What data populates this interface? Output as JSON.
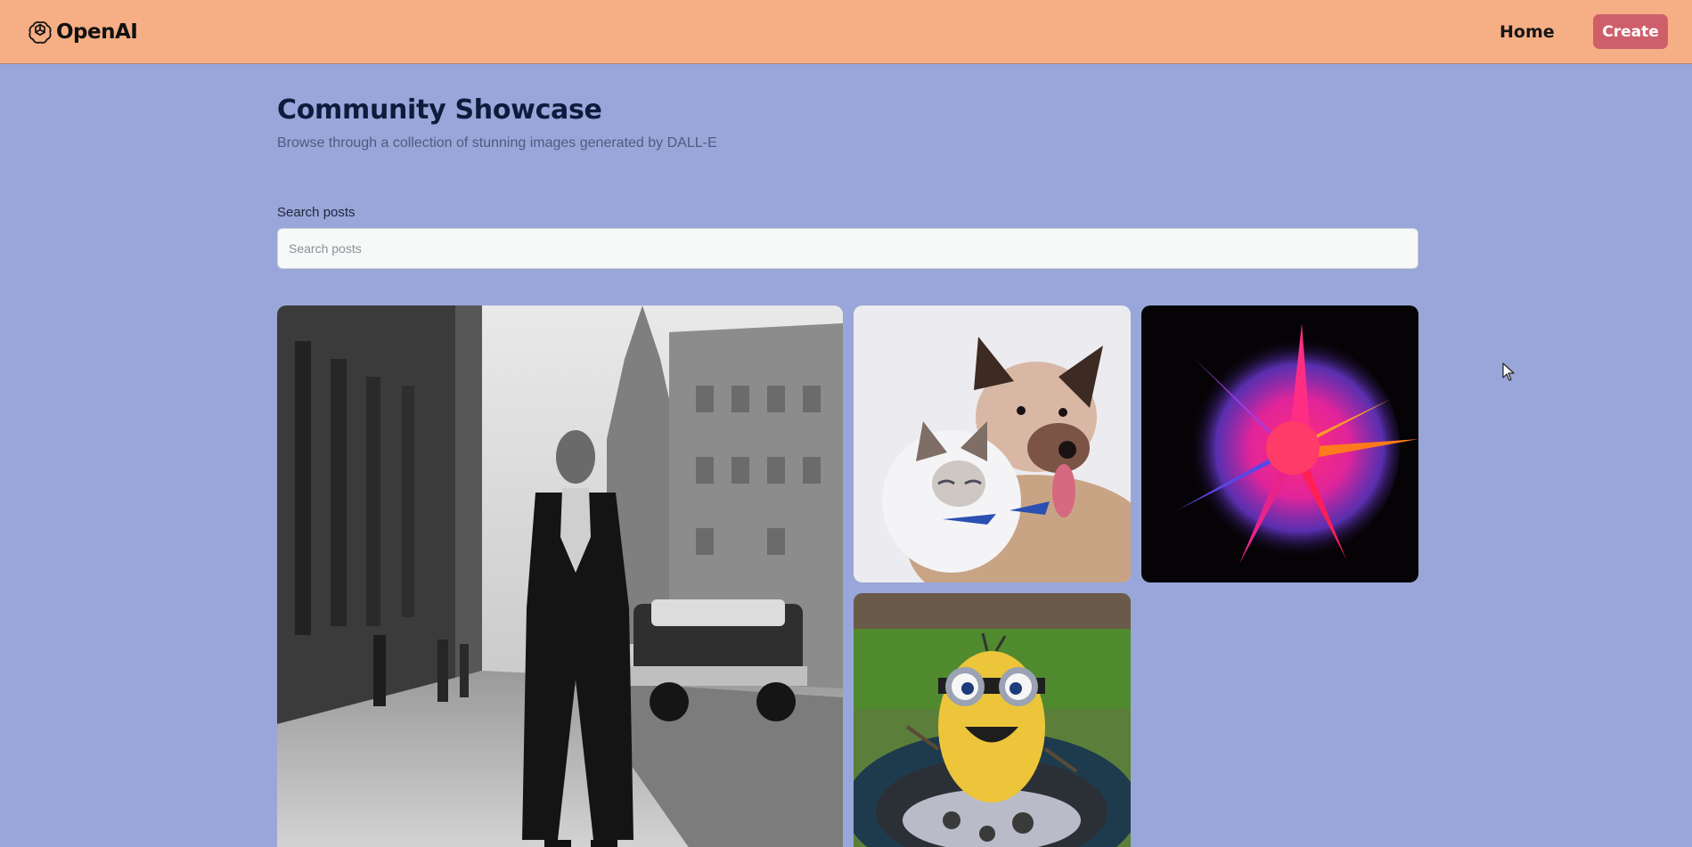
{
  "header": {
    "brand": "OpenAI",
    "nav_home": "Home",
    "create_label": "Create"
  },
  "main": {
    "title": "Community Showcase",
    "subtitle": "Browse through a collection of stunning images generated by DALL-E",
    "search": {
      "label": "Search posts",
      "placeholder": "Search posts",
      "value": ""
    }
  },
  "gallery": {
    "items": [
      {
        "icon": "street-photo-image"
      },
      {
        "icon": "cat-and-dog-image"
      },
      {
        "icon": "color-powder-explosion-image"
      },
      {
        "icon": "minion-robot-image"
      }
    ]
  },
  "colors": {
    "header_bg": "#f6ae85",
    "page_bg": "#99a6d9",
    "create_button": "#ce5f6a",
    "title": "#0f1b3d"
  }
}
